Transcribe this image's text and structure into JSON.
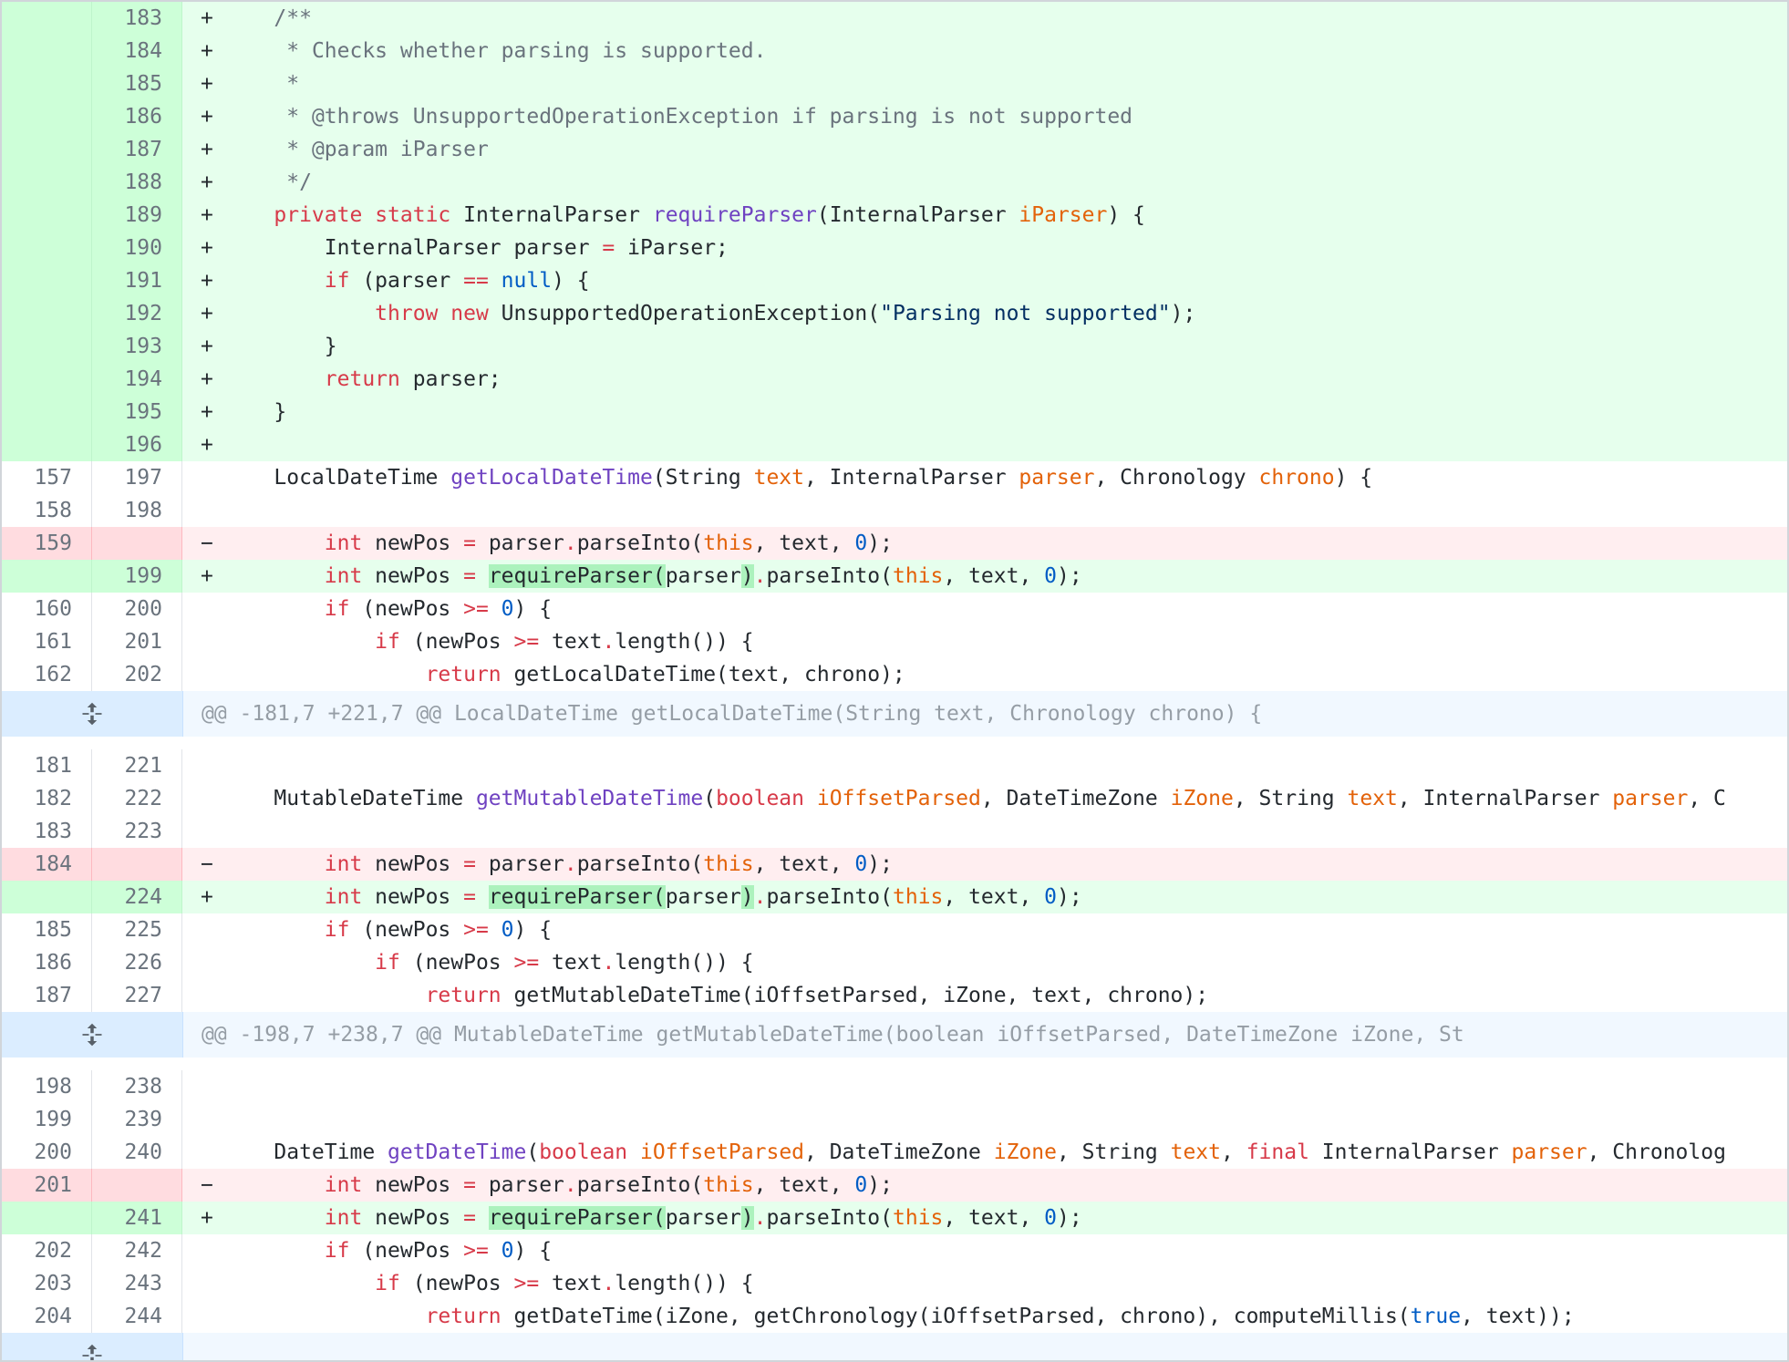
{
  "hunk1": {
    "lines": [
      {
        "type": "add",
        "old": "",
        "new": "183",
        "marker": "+",
        "segs": [
          {
            "t": "    "
          },
          {
            "t": "/**",
            "c": "c"
          }
        ]
      },
      {
        "type": "add",
        "old": "",
        "new": "184",
        "marker": "+",
        "segs": [
          {
            "t": "     "
          },
          {
            "t": "* Checks whether parsing is supported.",
            "c": "c"
          }
        ]
      },
      {
        "type": "add",
        "old": "",
        "new": "185",
        "marker": "+",
        "segs": [
          {
            "t": "     "
          },
          {
            "t": "*",
            "c": "c"
          }
        ]
      },
      {
        "type": "add",
        "old": "",
        "new": "186",
        "marker": "+",
        "segs": [
          {
            "t": "     "
          },
          {
            "t": "* @throws UnsupportedOperationException if parsing is not supported",
            "c": "c"
          }
        ]
      },
      {
        "type": "add",
        "old": "",
        "new": "187",
        "marker": "+",
        "segs": [
          {
            "t": "     "
          },
          {
            "t": "* @param iParser",
            "c": "c"
          }
        ]
      },
      {
        "type": "add",
        "old": "",
        "new": "188",
        "marker": "+",
        "segs": [
          {
            "t": "     "
          },
          {
            "t": "*/",
            "c": "c"
          }
        ]
      },
      {
        "type": "add",
        "old": "",
        "new": "189",
        "marker": "+",
        "segs": [
          {
            "t": "    "
          },
          {
            "t": "private",
            "c": "k"
          },
          {
            "t": " "
          },
          {
            "t": "static",
            "c": "k"
          },
          {
            "t": " InternalParser "
          },
          {
            "t": "requireParser",
            "c": "f"
          },
          {
            "t": "(InternalParser "
          },
          {
            "t": "iParser",
            "c": "p"
          },
          {
            "t": ") {"
          }
        ]
      },
      {
        "type": "add",
        "old": "",
        "new": "190",
        "marker": "+",
        "segs": [
          {
            "t": "        InternalParser parser "
          },
          {
            "t": "=",
            "c": "k"
          },
          {
            "t": " iParser;"
          }
        ]
      },
      {
        "type": "add",
        "old": "",
        "new": "191",
        "marker": "+",
        "segs": [
          {
            "t": "        "
          },
          {
            "t": "if",
            "c": "k"
          },
          {
            "t": " (parser "
          },
          {
            "t": "==",
            "c": "k"
          },
          {
            "t": " "
          },
          {
            "t": "null",
            "c": "n"
          },
          {
            "t": ") {"
          }
        ]
      },
      {
        "type": "add",
        "old": "",
        "new": "192",
        "marker": "+",
        "segs": [
          {
            "t": "            "
          },
          {
            "t": "throw",
            "c": "k"
          },
          {
            "t": " "
          },
          {
            "t": "new",
            "c": "k"
          },
          {
            "t": " UnsupportedOperationException("
          },
          {
            "t": "\"Parsing not supported\"",
            "c": "s"
          },
          {
            "t": ");"
          }
        ]
      },
      {
        "type": "add",
        "old": "",
        "new": "193",
        "marker": "+",
        "segs": [
          {
            "t": "        }"
          }
        ]
      },
      {
        "type": "add",
        "old": "",
        "new": "194",
        "marker": "+",
        "segs": [
          {
            "t": "        "
          },
          {
            "t": "return",
            "c": "k"
          },
          {
            "t": " parser;"
          }
        ]
      },
      {
        "type": "add",
        "old": "",
        "new": "195",
        "marker": "+",
        "segs": [
          {
            "t": "    }"
          }
        ]
      },
      {
        "type": "add",
        "old": "",
        "new": "196",
        "marker": "+",
        "segs": [
          {
            "t": ""
          }
        ]
      },
      {
        "type": "ctx",
        "old": "157",
        "new": "197",
        "marker": "",
        "segs": [
          {
            "t": "    LocalDateTime "
          },
          {
            "t": "getLocalDateTime",
            "c": "f"
          },
          {
            "t": "(String "
          },
          {
            "t": "text",
            "c": "p"
          },
          {
            "t": ", InternalParser "
          },
          {
            "t": "parser",
            "c": "p"
          },
          {
            "t": ", Chronology "
          },
          {
            "t": "chrono",
            "c": "p"
          },
          {
            "t": ") {"
          }
        ]
      },
      {
        "type": "ctx",
        "old": "158",
        "new": "198",
        "marker": "",
        "segs": [
          {
            "t": ""
          }
        ]
      },
      {
        "type": "del",
        "old": "159",
        "new": "",
        "marker": "−",
        "segs": [
          {
            "t": "        "
          },
          {
            "t": "int",
            "c": "k"
          },
          {
            "t": " newPos "
          },
          {
            "t": "=",
            "c": "k"
          },
          {
            "t": " parser"
          },
          {
            "t": ".",
            "c": "k"
          },
          {
            "t": "parseInto("
          },
          {
            "t": "this",
            "c": "p"
          },
          {
            "t": ", text, "
          },
          {
            "t": "0",
            "c": "n"
          },
          {
            "t": ");"
          }
        ]
      },
      {
        "type": "add",
        "old": "",
        "new": "199",
        "marker": "+",
        "segs": [
          {
            "t": "        "
          },
          {
            "t": "int",
            "c": "k"
          },
          {
            "t": " newPos "
          },
          {
            "t": "=",
            "c": "k"
          },
          {
            "t": " "
          },
          {
            "t": "requireParser(",
            "c": "hl"
          },
          {
            "t": "parser"
          },
          {
            "t": ")",
            "c": "hl"
          },
          {
            "t": ".",
            "c": "k"
          },
          {
            "t": "parseInto("
          },
          {
            "t": "this",
            "c": "p"
          },
          {
            "t": ", text, "
          },
          {
            "t": "0",
            "c": "n"
          },
          {
            "t": ");"
          }
        ]
      },
      {
        "type": "ctx",
        "old": "160",
        "new": "200",
        "marker": "",
        "segs": [
          {
            "t": "        "
          },
          {
            "t": "if",
            "c": "k"
          },
          {
            "t": " (newPos "
          },
          {
            "t": ">=",
            "c": "k"
          },
          {
            "t": " "
          },
          {
            "t": "0",
            "c": "n"
          },
          {
            "t": ") {"
          }
        ]
      },
      {
        "type": "ctx",
        "old": "161",
        "new": "201",
        "marker": "",
        "segs": [
          {
            "t": "            "
          },
          {
            "t": "if",
            "c": "k"
          },
          {
            "t": " (newPos "
          },
          {
            "t": ">=",
            "c": "k"
          },
          {
            "t": " text"
          },
          {
            "t": ".",
            "c": "k"
          },
          {
            "t": "length()) {"
          }
        ]
      },
      {
        "type": "ctx",
        "old": "162",
        "new": "202",
        "marker": "",
        "segs": [
          {
            "t": "                "
          },
          {
            "t": "return",
            "c": "k"
          },
          {
            "t": " getLocalDateTime(text, chrono);"
          }
        ]
      }
    ]
  },
  "hunk_header_1": "@@ -181,7 +221,7 @@ LocalDateTime getLocalDateTime(String text, Chronology chrono) {",
  "hunk2": {
    "lines": [
      {
        "type": "ctx",
        "old": "181",
        "new": "221",
        "marker": "",
        "segs": [
          {
            "t": ""
          }
        ]
      },
      {
        "type": "ctx",
        "old": "182",
        "new": "222",
        "marker": "",
        "segs": [
          {
            "t": "    MutableDateTime "
          },
          {
            "t": "getMutableDateTime",
            "c": "f"
          },
          {
            "t": "("
          },
          {
            "t": "boolean",
            "c": "k"
          },
          {
            "t": " "
          },
          {
            "t": "iOffsetParsed",
            "c": "p"
          },
          {
            "t": ", DateTimeZone "
          },
          {
            "t": "iZone",
            "c": "p"
          },
          {
            "t": ", String "
          },
          {
            "t": "text",
            "c": "p"
          },
          {
            "t": ", InternalParser "
          },
          {
            "t": "parser",
            "c": "p"
          },
          {
            "t": ", C"
          }
        ]
      },
      {
        "type": "ctx",
        "old": "183",
        "new": "223",
        "marker": "",
        "segs": [
          {
            "t": ""
          }
        ]
      },
      {
        "type": "del",
        "old": "184",
        "new": "",
        "marker": "−",
        "segs": [
          {
            "t": "        "
          },
          {
            "t": "int",
            "c": "k"
          },
          {
            "t": " newPos "
          },
          {
            "t": "=",
            "c": "k"
          },
          {
            "t": " parser"
          },
          {
            "t": ".",
            "c": "k"
          },
          {
            "t": "parseInto("
          },
          {
            "t": "this",
            "c": "p"
          },
          {
            "t": ", text, "
          },
          {
            "t": "0",
            "c": "n"
          },
          {
            "t": ");"
          }
        ]
      },
      {
        "type": "add",
        "old": "",
        "new": "224",
        "marker": "+",
        "segs": [
          {
            "t": "        "
          },
          {
            "t": "int",
            "c": "k"
          },
          {
            "t": " newPos "
          },
          {
            "t": "=",
            "c": "k"
          },
          {
            "t": " "
          },
          {
            "t": "requireParser(",
            "c": "hl"
          },
          {
            "t": "parser"
          },
          {
            "t": ")",
            "c": "hl"
          },
          {
            "t": ".",
            "c": "k"
          },
          {
            "t": "parseInto("
          },
          {
            "t": "this",
            "c": "p"
          },
          {
            "t": ", text, "
          },
          {
            "t": "0",
            "c": "n"
          },
          {
            "t": ");"
          }
        ]
      },
      {
        "type": "ctx",
        "old": "185",
        "new": "225",
        "marker": "",
        "segs": [
          {
            "t": "        "
          },
          {
            "t": "if",
            "c": "k"
          },
          {
            "t": " (newPos "
          },
          {
            "t": ">=",
            "c": "k"
          },
          {
            "t": " "
          },
          {
            "t": "0",
            "c": "n"
          },
          {
            "t": ") {"
          }
        ]
      },
      {
        "type": "ctx",
        "old": "186",
        "new": "226",
        "marker": "",
        "segs": [
          {
            "t": "            "
          },
          {
            "t": "if",
            "c": "k"
          },
          {
            "t": " (newPos "
          },
          {
            "t": ">=",
            "c": "k"
          },
          {
            "t": " text"
          },
          {
            "t": ".",
            "c": "k"
          },
          {
            "t": "length()) {"
          }
        ]
      },
      {
        "type": "ctx",
        "old": "187",
        "new": "227",
        "marker": "",
        "segs": [
          {
            "t": "                "
          },
          {
            "t": "return",
            "c": "k"
          },
          {
            "t": " getMutableDateTime(iOffsetParsed, iZone, text, chrono);"
          }
        ]
      }
    ]
  },
  "hunk_header_2": "@@ -198,7 +238,7 @@ MutableDateTime getMutableDateTime(boolean iOffsetParsed, DateTimeZone iZone, St",
  "hunk3": {
    "lines": [
      {
        "type": "ctx",
        "old": "198",
        "new": "238",
        "marker": "",
        "segs": [
          {
            "t": ""
          }
        ]
      },
      {
        "type": "ctx",
        "old": "199",
        "new": "239",
        "marker": "",
        "segs": [
          {
            "t": ""
          }
        ]
      },
      {
        "type": "ctx",
        "old": "200",
        "new": "240",
        "marker": "",
        "segs": [
          {
            "t": "    DateTime "
          },
          {
            "t": "getDateTime",
            "c": "f"
          },
          {
            "t": "("
          },
          {
            "t": "boolean",
            "c": "k"
          },
          {
            "t": " "
          },
          {
            "t": "iOffsetParsed",
            "c": "p"
          },
          {
            "t": ", DateTimeZone "
          },
          {
            "t": "iZone",
            "c": "p"
          },
          {
            "t": ", String "
          },
          {
            "t": "text",
            "c": "p"
          },
          {
            "t": ", "
          },
          {
            "t": "final",
            "c": "k"
          },
          {
            "t": " InternalParser "
          },
          {
            "t": "parser",
            "c": "p"
          },
          {
            "t": ", Chronolog"
          }
        ]
      },
      {
        "type": "del",
        "old": "201",
        "new": "",
        "marker": "−",
        "segs": [
          {
            "t": "        "
          },
          {
            "t": "int",
            "c": "k"
          },
          {
            "t": " newPos "
          },
          {
            "t": "=",
            "c": "k"
          },
          {
            "t": " parser"
          },
          {
            "t": ".",
            "c": "k"
          },
          {
            "t": "parseInto("
          },
          {
            "t": "this",
            "c": "p"
          },
          {
            "t": ", text, "
          },
          {
            "t": "0",
            "c": "n"
          },
          {
            "t": ");"
          }
        ]
      },
      {
        "type": "add",
        "old": "",
        "new": "241",
        "marker": "+",
        "segs": [
          {
            "t": "        "
          },
          {
            "t": "int",
            "c": "k"
          },
          {
            "t": " newPos "
          },
          {
            "t": "=",
            "c": "k"
          },
          {
            "t": " "
          },
          {
            "t": "requireParser(",
            "c": "hl"
          },
          {
            "t": "parser"
          },
          {
            "t": ")",
            "c": "hl"
          },
          {
            "t": ".",
            "c": "k"
          },
          {
            "t": "parseInto("
          },
          {
            "t": "this",
            "c": "p"
          },
          {
            "t": ", text, "
          },
          {
            "t": "0",
            "c": "n"
          },
          {
            "t": ");"
          }
        ]
      },
      {
        "type": "ctx",
        "old": "202",
        "new": "242",
        "marker": "",
        "segs": [
          {
            "t": "        "
          },
          {
            "t": "if",
            "c": "k"
          },
          {
            "t": " (newPos "
          },
          {
            "t": ">=",
            "c": "k"
          },
          {
            "t": " "
          },
          {
            "t": "0",
            "c": "n"
          },
          {
            "t": ") {"
          }
        ]
      },
      {
        "type": "ctx",
        "old": "203",
        "new": "243",
        "marker": "",
        "segs": [
          {
            "t": "            "
          },
          {
            "t": "if",
            "c": "k"
          },
          {
            "t": " (newPos "
          },
          {
            "t": ">=",
            "c": "k"
          },
          {
            "t": " text"
          },
          {
            "t": ".",
            "c": "k"
          },
          {
            "t": "length()) {"
          }
        ]
      },
      {
        "type": "ctx",
        "old": "204",
        "new": "244",
        "marker": "",
        "segs": [
          {
            "t": "                "
          },
          {
            "t": "return",
            "c": "k"
          },
          {
            "t": " getDateTime(iZone, getChronology(iOffsetParsed, chrono), computeMillis("
          },
          {
            "t": "true",
            "c": "n"
          },
          {
            "t": ", text));"
          }
        ]
      }
    ]
  },
  "icons": {
    "expand": "unfold-icon"
  },
  "colors": {
    "add_bg": "#e6ffed",
    "add_num_bg": "#cdffd8",
    "del_bg": "#ffeef0",
    "del_num_bg": "#ffdce0",
    "hunk_bg": "#f1f8ff",
    "hunk_expand_bg": "#dbedff"
  }
}
